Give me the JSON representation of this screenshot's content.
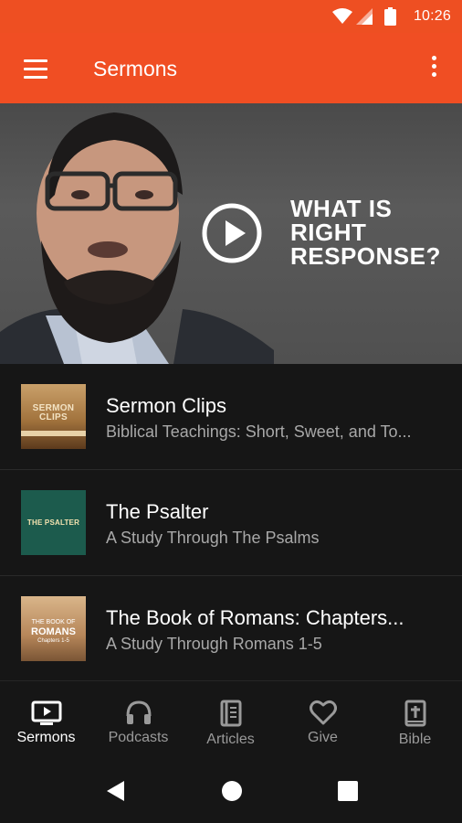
{
  "status_bar": {
    "time": "10:26"
  },
  "app_bar": {
    "title": "Sermons"
  },
  "hero": {
    "headline_lines": [
      "WHAT IS",
      "RIGHT",
      "RESPONSE?"
    ]
  },
  "series": [
    {
      "title": "Sermon Clips",
      "subtitle": "Biblical Teachings: Short, Sweet, and To...",
      "thumb_text": [
        "SERMON",
        "CLIPS"
      ]
    },
    {
      "title": "The Psalter",
      "subtitle": "A Study Through The Psalms",
      "thumb_text": [
        "THE PSALTER"
      ]
    },
    {
      "title": "The Book of Romans: Chapters...",
      "subtitle": "A Study Through Romans 1-5",
      "thumb_text": [
        "THE BOOK OF",
        "ROMANS",
        "Chapters 1-5"
      ]
    }
  ],
  "bottom_nav": [
    {
      "label": "Sermons",
      "icon": "tv-play-icon",
      "active": true
    },
    {
      "label": "Podcasts",
      "icon": "headphones-icon",
      "active": false
    },
    {
      "label": "Articles",
      "icon": "book-icon",
      "active": false
    },
    {
      "label": "Give",
      "icon": "heart-icon",
      "active": false
    },
    {
      "label": "Bible",
      "icon": "bible-cross-icon",
      "active": false
    }
  ],
  "colors": {
    "accent": "#f04e23",
    "background": "#161616",
    "text_secondary": "#a8a8a8"
  }
}
